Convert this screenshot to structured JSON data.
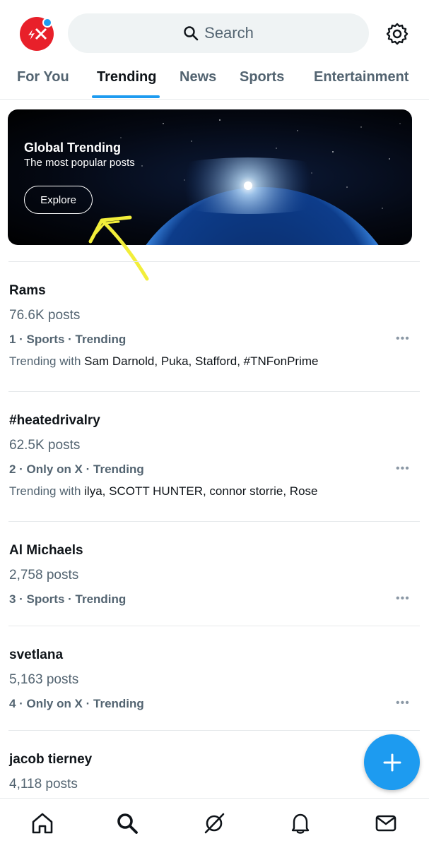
{
  "header": {
    "avatar_icon": "x-logo-avatar-icon",
    "search_placeholder": "Search",
    "settings_icon": "gear-icon"
  },
  "tabs": [
    {
      "label": "For You",
      "active": false
    },
    {
      "label": "Trending",
      "active": true
    },
    {
      "label": "News",
      "active": false
    },
    {
      "label": "Sports",
      "active": false
    },
    {
      "label": "Entertainment",
      "active": false
    }
  ],
  "banner": {
    "title": "Global Trending",
    "subtitle": "The most popular posts",
    "button_label": "Explore"
  },
  "trends": [
    {
      "title": "Rams",
      "count": "76.6K posts",
      "meta": "1 · Sports · Trending",
      "with_prefix": "Trending with",
      "with_names": "Sam Darnold, Puka, Stafford, #TNFonPrime"
    },
    {
      "title": "#heatedrivalry",
      "count": "62.5K posts",
      "meta": "2 · Only on X · Trending",
      "with_prefix": "Trending with",
      "with_names": "ilya, SCOTT HUNTER, connor storrie, Rose"
    },
    {
      "title": "Al Michaels",
      "count": "2,758 posts",
      "meta": "3 · Sports · Trending"
    },
    {
      "title": "svetlana",
      "count": "5,163 posts",
      "meta": "4 · Only on X · Trending"
    },
    {
      "title": "jacob tierney",
      "count": "4,118 posts"
    }
  ],
  "more_label": "•••",
  "colors": {
    "accent": "#1d9bf0",
    "avatar_red": "#e8202a",
    "muted_text": "#536471",
    "annotation_yellow": "#f2ee3a"
  },
  "bottom_nav": [
    "home-icon",
    "search-icon",
    "grok-icon",
    "bell-icon",
    "mail-icon"
  ]
}
